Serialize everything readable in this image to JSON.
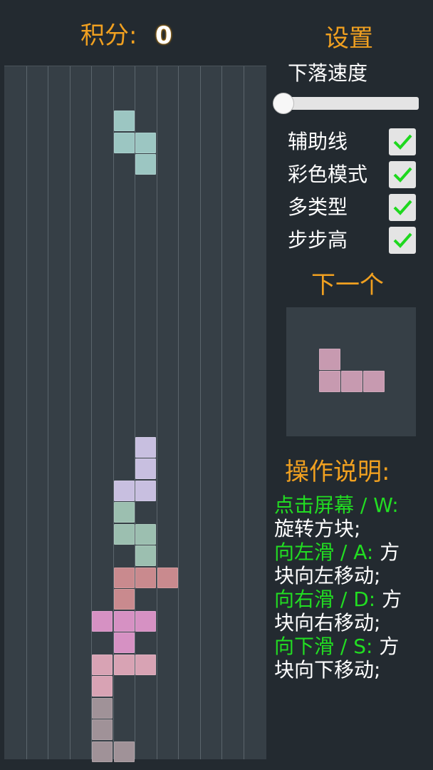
{
  "score": {
    "label": "积分:",
    "value": "0"
  },
  "settings": {
    "title": "设置",
    "speed_label": "下落速度",
    "speed_value": 0,
    "options": [
      {
        "label": "辅助线",
        "checked": true
      },
      {
        "label": "彩色模式",
        "checked": true
      },
      {
        "label": "多类型",
        "checked": true
      },
      {
        "label": "步步高",
        "checked": true
      }
    ]
  },
  "next": {
    "title": "下一个",
    "piece": {
      "color": "#c79ab0",
      "cells": [
        [
          0,
          0
        ],
        [
          0,
          1
        ],
        [
          1,
          1
        ],
        [
          2,
          1
        ]
      ]
    }
  },
  "help": {
    "title": "操作说明:",
    "lines": [
      {
        "key": "点击屏幕 / W:",
        "text": ""
      },
      {
        "key": "",
        "text": "旋转方块;"
      },
      {
        "key": "向左滑 / A:",
        "text": " 方"
      },
      {
        "key": "",
        "text": "块向左移动;"
      },
      {
        "key": "向右滑 / D:",
        "text": " 方"
      },
      {
        "key": "",
        "text": "块向右移动;"
      },
      {
        "key": "向下滑 / S:",
        "text": " 方"
      },
      {
        "key": "",
        "text": "块向下移动;"
      }
    ]
  },
  "board": {
    "columns": 12,
    "rows": 32,
    "falling_piece": {
      "color": "#9cc6c2",
      "cells": [
        [
          5,
          2
        ],
        [
          5,
          3
        ],
        [
          6,
          3
        ],
        [
          6,
          4
        ]
      ]
    },
    "stack": [
      {
        "color": "#c8bfe0",
        "cells": [
          [
            6,
            17
          ],
          [
            6,
            18
          ],
          [
            5,
            19
          ],
          [
            6,
            19
          ]
        ]
      },
      {
        "color": "#9cbfb0",
        "cells": [
          [
            5,
            20
          ],
          [
            5,
            21
          ],
          [
            6,
            21
          ],
          [
            6,
            22
          ]
        ]
      },
      {
        "color": "#c98a8e",
        "cells": [
          [
            5,
            23
          ],
          [
            6,
            23
          ],
          [
            7,
            23
          ],
          [
            5,
            24
          ]
        ]
      },
      {
        "color": "#d691c3",
        "cells": [
          [
            4,
            25
          ],
          [
            5,
            25
          ],
          [
            6,
            25
          ],
          [
            5,
            26
          ]
        ]
      },
      {
        "color": "#d8a3b4",
        "cells": [
          [
            4,
            27
          ],
          [
            5,
            27
          ],
          [
            6,
            27
          ],
          [
            4,
            28
          ]
        ]
      },
      {
        "color": "#a09298",
        "cells": [
          [
            4,
            29
          ],
          [
            4,
            30
          ],
          [
            4,
            31
          ],
          [
            5,
            31
          ]
        ]
      }
    ]
  }
}
